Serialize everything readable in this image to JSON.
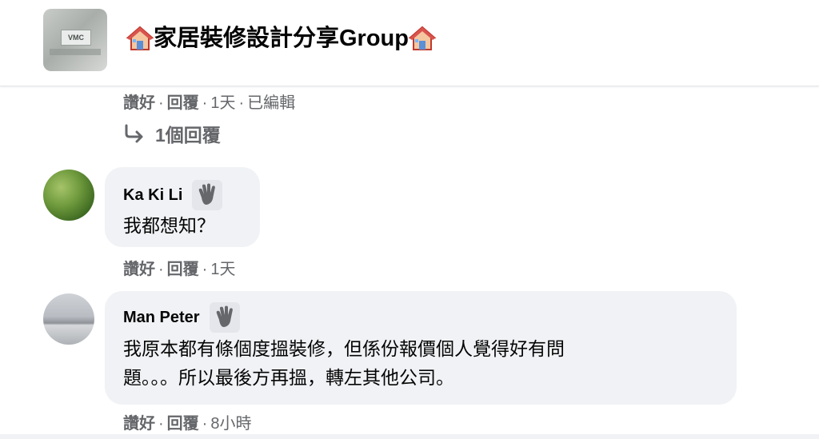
{
  "group": {
    "title": "家居裝修設計分享Group",
    "title_icon": "house-emoji-icon",
    "thumb_text": "VMC"
  },
  "prev_comment_meta": {
    "like": "讚好",
    "reply": "回覆",
    "time": "1天",
    "edited": "已編輯"
  },
  "replies_link": {
    "label": "1個回覆",
    "icon": "reply-arrow-icon"
  },
  "comments": [
    {
      "author": "Ka Ki Li",
      "badge_icon": "waving-hand-icon",
      "text": "我都想知？",
      "like": "讚好",
      "reply": "回覆",
      "time": "1天"
    },
    {
      "author": "Man Peter",
      "badge_icon": "waving-hand-icon",
      "text_line1": "我原本都有條個度搵裝修，但係份報價個人覺得好有問",
      "text_line2": "題。。。所以最後方再搵，轉左其他公司。",
      "like": "讚好",
      "reply": "回覆",
      "time": "8小時"
    }
  ],
  "colors": {
    "meta_gray": "#65676b",
    "bubble_bg": "#f0f2f5",
    "text": "#050505"
  }
}
